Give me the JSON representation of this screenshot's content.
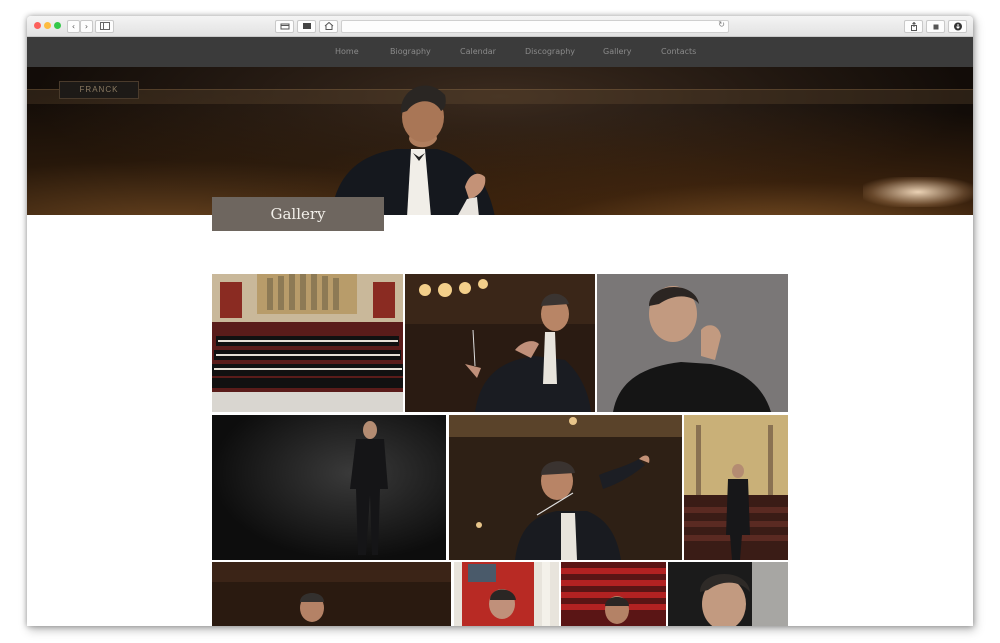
{
  "nav": {
    "items": [
      "Home",
      "Biography",
      "Calendar",
      "Discography",
      "Gallery",
      "Contacts"
    ]
  },
  "hero": {
    "sign_text": "FRANCK"
  },
  "page": {
    "title": "Gallery"
  },
  "browser": {
    "back_glyph": "‹",
    "forward_glyph": "›",
    "reload_glyph": "↻"
  }
}
